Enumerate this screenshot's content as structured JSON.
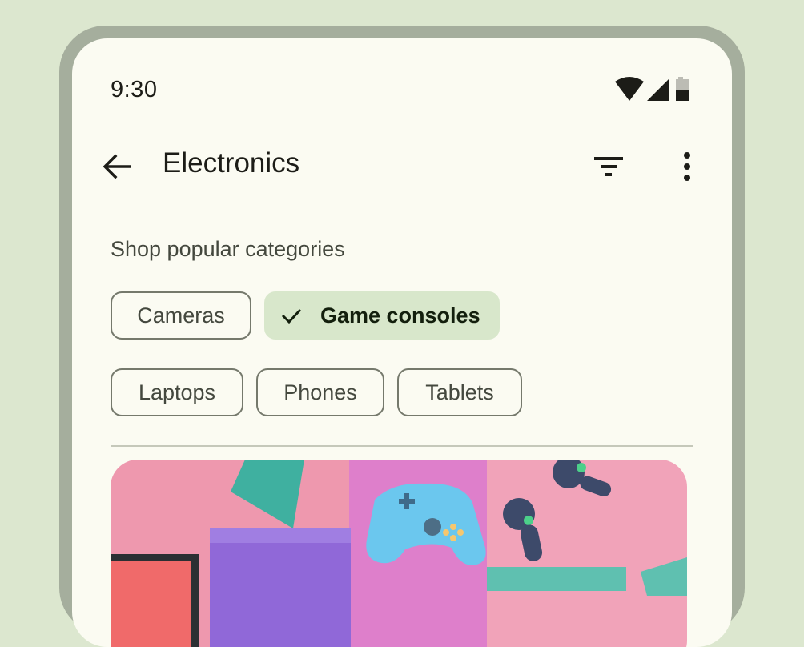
{
  "status": {
    "time": "9:30"
  },
  "topbar": {
    "title": "Electronics"
  },
  "section": {
    "label": "Shop popular categories"
  },
  "chips": [
    {
      "label": "Cameras",
      "selected": false
    },
    {
      "label": "Game consoles",
      "selected": true
    },
    {
      "label": "Laptops",
      "selected": false
    },
    {
      "label": "Phones",
      "selected": false
    },
    {
      "label": "Tablets",
      "selected": false
    }
  ],
  "icons": {
    "back": "arrow-back-icon",
    "filter": "filter-icon",
    "more": "more-vert-icon",
    "wifi": "wifi-icon",
    "signal": "cellular-signal-icon",
    "battery": "battery-icon",
    "check": "check-icon"
  },
  "colors": {
    "background": "#dce7cf",
    "device_frame": "#a5ae9d",
    "surface": "#fbfbf2",
    "selected_chip": "#d8e7cb",
    "outline": "#75796c"
  }
}
